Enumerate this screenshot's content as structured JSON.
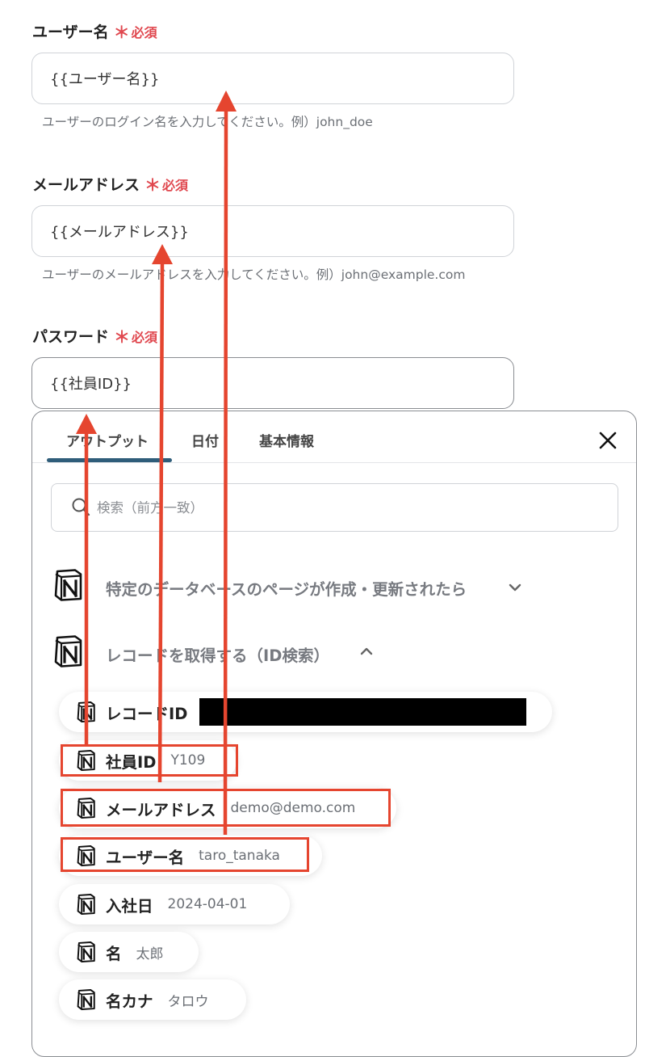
{
  "form": {
    "username": {
      "label": "ユーザー名",
      "required_star": "＊",
      "required_text": "必須",
      "value": "{{ユーザー名}}",
      "hint": "ユーザーのログイン名を入力してください。例）john_doe"
    },
    "email": {
      "label": "メールアドレス",
      "required_star": "＊",
      "required_text": "必須",
      "value": "{{メールアドレス}}",
      "hint": "ユーザーのメールアドレスを入力してください。例）john@example.com"
    },
    "password": {
      "label": "パスワード",
      "required_star": "＊",
      "required_text": "必須",
      "value": "{{社員ID}}"
    }
  },
  "panel": {
    "tabs": [
      {
        "label": "アウトプット"
      },
      {
        "label": "日付"
      },
      {
        "label": "基本情報"
      }
    ],
    "search_placeholder": "検索（前方一致）",
    "sections": [
      {
        "title": "特定のデータベースのページが作成・更新されたら",
        "expanded": false
      },
      {
        "title": "レコードを取得する（ID検索）",
        "expanded": true
      }
    ],
    "outputs": [
      {
        "label": "レコードID",
        "value": ""
      },
      {
        "label": "社員ID",
        "value": "Y109"
      },
      {
        "label": "メールアドレス",
        "value": "demo@demo.com"
      },
      {
        "label": "ユーザー名",
        "value": "taro_tanaka"
      },
      {
        "label": "入社日",
        "value": "2024-04-01"
      },
      {
        "label": "名",
        "value": "太郎"
      },
      {
        "label": "名カナ",
        "value": "タロウ"
      }
    ]
  },
  "colors": {
    "required": "#e0484f",
    "annotation": "#e5452f",
    "tab_underline": "#2f5d7a"
  },
  "icons": [
    "notion-icon",
    "search-icon",
    "close-icon",
    "chevron-down-icon",
    "chevron-up-icon"
  ]
}
